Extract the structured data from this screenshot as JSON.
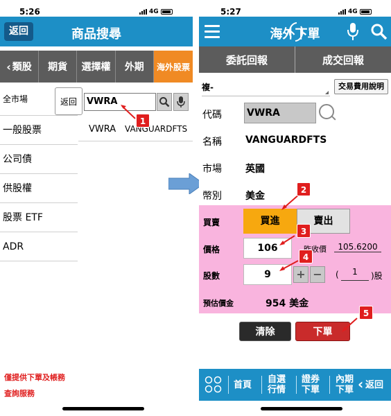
{
  "left": {
    "status": {
      "time": "5:26",
      "network": "4G"
    },
    "header": {
      "title": "商品搜尋",
      "back": "返回"
    },
    "categories": [
      "類股",
      "期貨",
      "選擇權",
      "外期",
      "海外股票"
    ],
    "side_items": [
      "全市場",
      "一般股票",
      "公司債",
      "供股權",
      "股票 ETF",
      "ADR"
    ],
    "search": {
      "return_label": "返回",
      "query": "VWRA"
    },
    "result": {
      "code": "VWRA",
      "name": "VANGUARDFTS"
    },
    "footnote": [
      "僅提供下單及帳務",
      "查詢服務"
    ]
  },
  "right": {
    "status": {
      "time": "5:27",
      "network": "4G"
    },
    "header": {
      "title": "海外下單"
    },
    "tabs": [
      "委託回報",
      "成交回報"
    ],
    "account_select": "複-",
    "fee_button": "交易費用說明",
    "fields": {
      "code_label": "代碼",
      "code": "VWRA",
      "name_label": "名稱",
      "name": "VANGUARDFTS",
      "market_label": "市場",
      "market": "英國",
      "currency_label": "幣別",
      "currency": "美金"
    },
    "order": {
      "side_label": "買賣",
      "buy": "買進",
      "sell": "賣出",
      "price_label": "價格",
      "price": "106",
      "prev_close_label": "昨收價",
      "prev_close": "105.6200",
      "qty_label": "股數",
      "qty": "9",
      "plus": "+",
      "minus": "−",
      "lot_open": "(",
      "lot_value": "1",
      "lot_unit": ")股",
      "estimate_label": "預估價金",
      "estimate": "954 美金"
    },
    "clear_button": "清除",
    "order_button": "下單",
    "bottom_nav": [
      "首頁",
      "自選\n行情",
      "證券\n下單",
      "內期\n下單",
      "返回"
    ]
  },
  "markers": [
    "1",
    "2",
    "3",
    "4",
    "5"
  ],
  "colors": {
    "brand_blue": "#1d8fc6",
    "tab_orange": "#f08a24",
    "buy_orange": "#f7a80f",
    "panel_pink": "#f9b4de",
    "order_red": "#c92b2b",
    "marker_red": "#e01e1e"
  }
}
